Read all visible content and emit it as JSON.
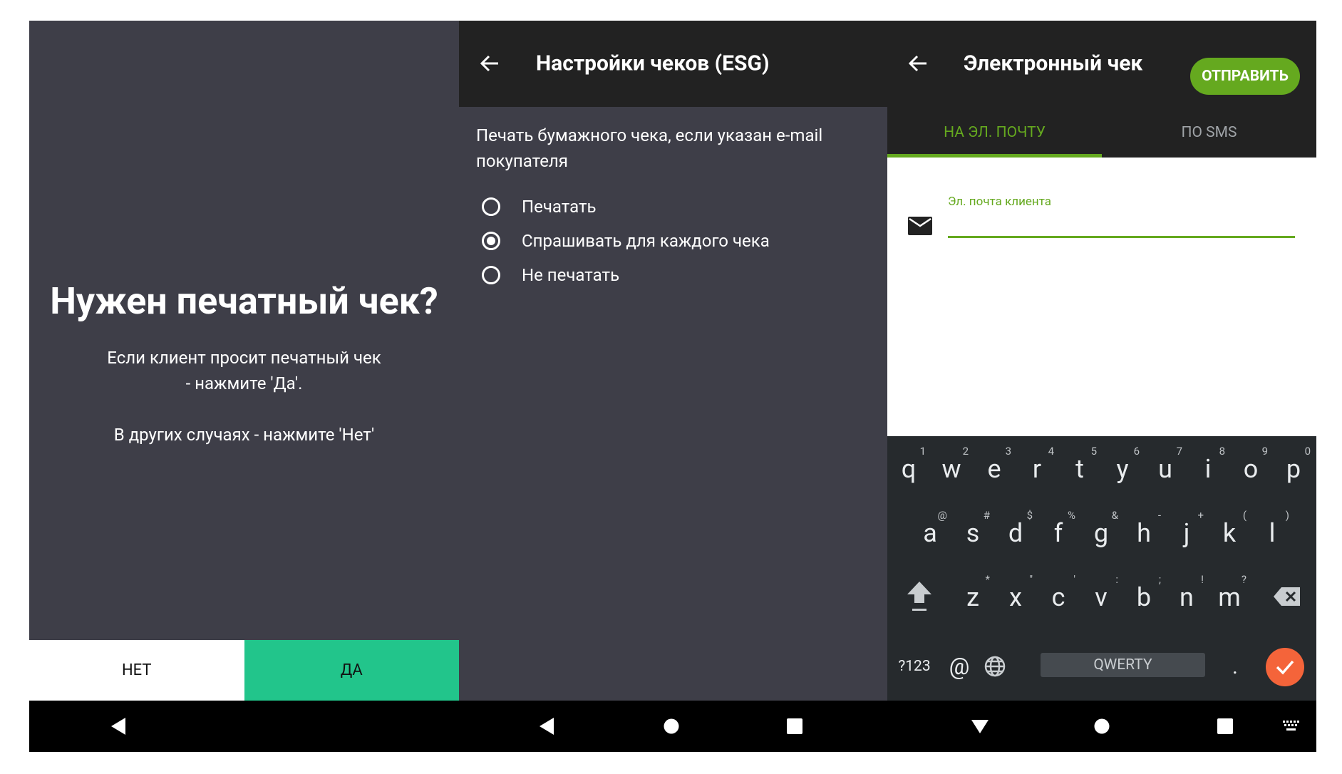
{
  "screen1": {
    "title": "Нужен печатный чек?",
    "text_line1": "Если клиент просит печатный чек",
    "text_line2": "- нажмите 'Да'.",
    "text_line3": "В других случаях - нажмите 'Нет'",
    "no_label": "НЕТ",
    "yes_label": "ДА",
    "colors": {
      "background": "#3e3e48",
      "yes": "#22c58b",
      "no": "#ffffff"
    }
  },
  "screen2": {
    "title": "Настройки чеков (ESG)",
    "description": "Печать бумажного чека, если указан e-mail покупателя",
    "options": [
      {
        "label": "Печатать",
        "selected": false
      },
      {
        "label": "Спрашивать для каждого чека",
        "selected": true
      },
      {
        "label": "Не печатать",
        "selected": false
      }
    ]
  },
  "screen3": {
    "title": "Электронный чек",
    "send_label": "ОТПРАВИТЬ",
    "tabs": [
      {
        "label": "НА ЭЛ. ПОЧТУ",
        "active": true
      },
      {
        "label": "ПО SMS",
        "active": false
      }
    ],
    "email_label": "Эл. почта клиента",
    "email_value": "",
    "accent_color": "#65a91f",
    "keyboard": {
      "row1": [
        {
          "ch": "q",
          "hint": "1"
        },
        {
          "ch": "w",
          "hint": "2"
        },
        {
          "ch": "e",
          "hint": "3"
        },
        {
          "ch": "r",
          "hint": "4"
        },
        {
          "ch": "t",
          "hint": "5"
        },
        {
          "ch": "y",
          "hint": "6"
        },
        {
          "ch": "u",
          "hint": "7"
        },
        {
          "ch": "i",
          "hint": "8"
        },
        {
          "ch": "o",
          "hint": "9"
        },
        {
          "ch": "p",
          "hint": "0"
        }
      ],
      "row2": [
        {
          "ch": "a",
          "hint": "@"
        },
        {
          "ch": "s",
          "hint": "#"
        },
        {
          "ch": "d",
          "hint": "$"
        },
        {
          "ch": "f",
          "hint": "%"
        },
        {
          "ch": "g",
          "hint": "&"
        },
        {
          "ch": "h",
          "hint": "-"
        },
        {
          "ch": "j",
          "hint": "+"
        },
        {
          "ch": "k",
          "hint": "("
        },
        {
          "ch": "l",
          "hint": ")"
        }
      ],
      "row3": [
        {
          "ch": "z",
          "hint": "*"
        },
        {
          "ch": "x",
          "hint": "\""
        },
        {
          "ch": "c",
          "hint": "'"
        },
        {
          "ch": "v",
          "hint": ":"
        },
        {
          "ch": "b",
          "hint": ";"
        },
        {
          "ch": "n",
          "hint": "!"
        },
        {
          "ch": "m",
          "hint": "?"
        }
      ],
      "symbols_label": "?123",
      "at_label": "@",
      "space_label": "QWERTY",
      "period_label": "."
    }
  }
}
